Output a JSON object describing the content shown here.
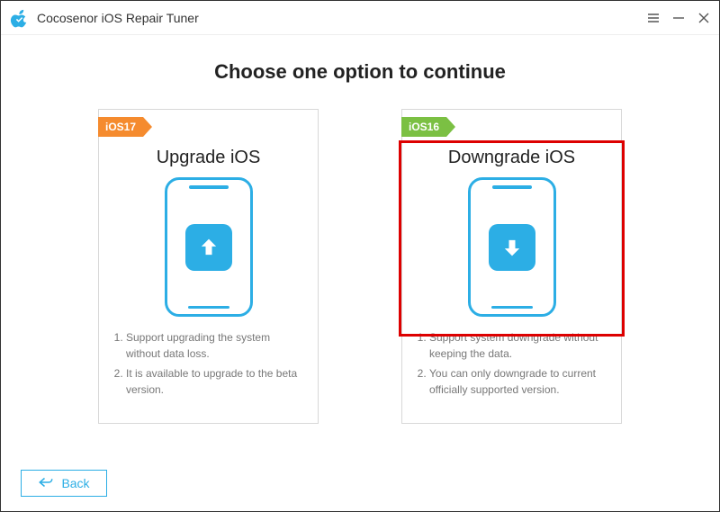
{
  "window": {
    "title": "Cocosenor iOS Repair Tuner"
  },
  "heading": "Choose one option to continue",
  "cards": {
    "upgrade": {
      "ribbon": "iOS17",
      "title": "Upgrade iOS",
      "bullet1": "Support upgrading the system without data loss.",
      "bullet2": "It is available to upgrade to the beta version."
    },
    "downgrade": {
      "ribbon": "iOS16",
      "title": "Downgrade iOS",
      "bullet1": "Support system downgrade without keeping the data.",
      "bullet2": "You can only downgrade to current officially supported version."
    }
  },
  "back_label": "Back",
  "colors": {
    "accent": "#2caee5",
    "ribbon_upgrade": "#f58b2e",
    "ribbon_downgrade": "#7bc043",
    "highlight": "#d00"
  }
}
